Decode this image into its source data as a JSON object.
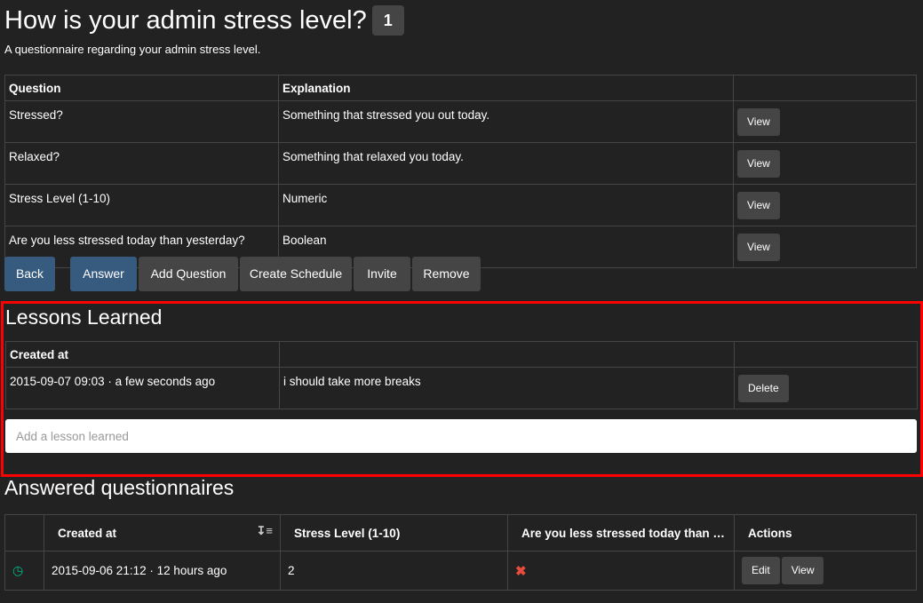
{
  "page": {
    "title": "How is your admin stress level?",
    "badge": "1",
    "subtitle": "A questionnaire regarding your admin stress level."
  },
  "questions_table": {
    "headers": [
      "Question",
      "Explanation",
      ""
    ],
    "rows": [
      {
        "question": "Stressed?",
        "explanation": "Something that stressed you out today.",
        "action": "View"
      },
      {
        "question": "Relaxed?",
        "explanation": "Something that relaxed you today.",
        "action": "View"
      },
      {
        "question": "Stress Level (1-10)",
        "explanation": "Numeric",
        "action": "View"
      },
      {
        "question": "Are you less stressed today than yesterday?",
        "explanation": "Boolean",
        "action": "View"
      }
    ]
  },
  "toolbar": {
    "back": "Back",
    "answer": "Answer",
    "add_question": "Add Question",
    "create_schedule": "Create Schedule",
    "invite": "Invite",
    "remove": "Remove"
  },
  "lessons": {
    "title": "Lessons Learned",
    "headers": [
      "Created at",
      "",
      ""
    ],
    "rows": [
      {
        "created_at": "2015-09-07 09:03 · a few seconds ago",
        "text": "i should take more breaks",
        "action": "Delete"
      }
    ],
    "input_placeholder": "Add a lesson learned"
  },
  "answered": {
    "title": "Answered questionnaires",
    "headers": [
      "",
      "Created at",
      "Stress Level (1-10)",
      "Are you less stressed today than …",
      "Actions"
    ],
    "rows": [
      {
        "status_icon": "clock-icon",
        "created_at": "2015-09-06 21:12 · 12 hours ago",
        "stress_level": "2",
        "less_stressed_icon": "x-icon",
        "edit": "Edit",
        "view": "View"
      }
    ]
  },
  "colors": {
    "background": "#222222",
    "primary": "#375a7f",
    "default_button": "#464545",
    "success": "#00bc8c",
    "danger": "#e74c3c",
    "highlight_border": "#ff0000"
  }
}
